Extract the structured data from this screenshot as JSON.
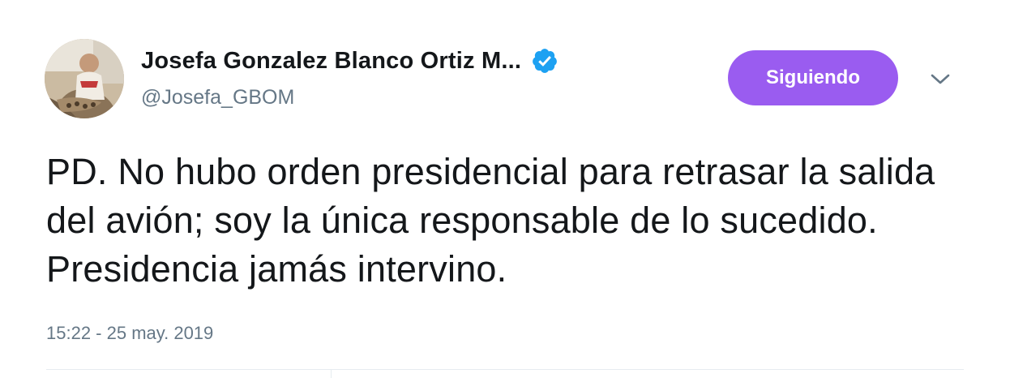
{
  "author": {
    "display_name": "Josefa Gonzalez Blanco Ortiz M...",
    "handle": "@Josefa_GBOM",
    "verified": true
  },
  "follow_button": {
    "label": "Siguiendo"
  },
  "tweet": {
    "text": "PD. No hubo orden presidencial para retrasar la salida del avión; soy la única responsable de lo sucedido. Presidencia jamás intervino.",
    "timestamp": "15:22 - 25 may. 2019"
  },
  "icons": {
    "verified": "verified-badge-icon",
    "more": "chevron-down-icon"
  },
  "colors": {
    "follow_button_bg": "#9a5cf0",
    "verified_badge": "#1da1f2",
    "secondary_text": "#657786",
    "primary_text": "#14171a"
  }
}
